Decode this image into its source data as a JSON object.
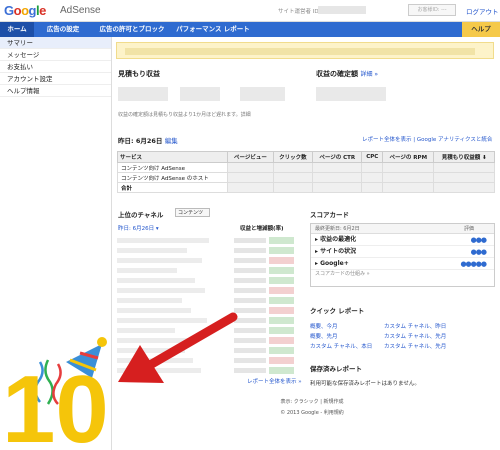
{
  "header": {
    "logo_letters": [
      "G",
      "o",
      "o",
      "g",
      "l",
      "e"
    ],
    "product": "AdSense",
    "publisher_label": "サイト運営者 ID",
    "status_button": "お客様ID: ---",
    "logout": "ログアウト"
  },
  "nav": {
    "tabs": [
      "ホーム",
      "広告の設定",
      "広告の許可とブロック",
      "パフォーマンス レポート"
    ],
    "help": "ヘルプ"
  },
  "sidebar": {
    "items": [
      "サマリー",
      "メッセージ",
      "お支払い",
      "アカウント設定",
      "ヘルプ情報"
    ]
  },
  "estimated": {
    "title": "見積もり収益",
    "note": "収益の確定額は見積もり収益より1か月ほど遅れます。詳細"
  },
  "confirmed": {
    "title": "収益の確定額",
    "link": "詳細 »"
  },
  "yesterday": {
    "label": "昨日: 6月26日",
    "edit": "編集",
    "links": "レポート全体を表示 | Google アナリティクスと統合"
  },
  "services_table": {
    "headers": [
      "サービス",
      "ページビュー",
      "クリック数",
      "ページの CTR",
      "CPC",
      "ページの RPM",
      "見積もり収益額 ⬇"
    ],
    "rows": [
      "コンテンツ向け AdSense",
      "コンテンツ向け AdSense のホスト",
      "合計"
    ]
  },
  "channels": {
    "title": "上位のチャネル",
    "select": "コンテンツ",
    "date": "昨日: 6月26日 ▾",
    "col_header": "収益と増減額(率)",
    "view_all": "レポート全体を表示 »"
  },
  "scorecard": {
    "title": "スコアカード",
    "header_left": "最終更新日: 6月2日",
    "header_right": "評価",
    "rows": [
      {
        "label": "収益の最適化",
        "dots": "●●●"
      },
      {
        "label": "サイトの状況",
        "dots": "●●●"
      },
      {
        "label": "Google+",
        "dots": "●●●●●"
      }
    ],
    "footer": "スコアカードの仕組み »"
  },
  "quick_reports": {
    "title": "クイック レポート",
    "links": [
      "概要、今月",
      "カスタム チャネル、昨日",
      "概要、先月",
      "カスタム チャネル、先月",
      "カスタム チャネル、本日",
      "カスタム チャネル、先月"
    ]
  },
  "saved_reports": {
    "title": "保存済みレポート",
    "empty": "利用可能な保存済みレポートはありません。"
  },
  "footer": {
    "display": "表示: クラシック | 新規作成",
    "copyright": "© 2013 Google - 利用規約"
  },
  "badge": {
    "number": "10"
  },
  "colors": {
    "nav_blue": "#2f6bd0",
    "help_yellow": "#f5c94a",
    "link_blue": "#2255cc",
    "arrow_red": "#d61f1f",
    "badge_yellow": "#f5c50a"
  }
}
